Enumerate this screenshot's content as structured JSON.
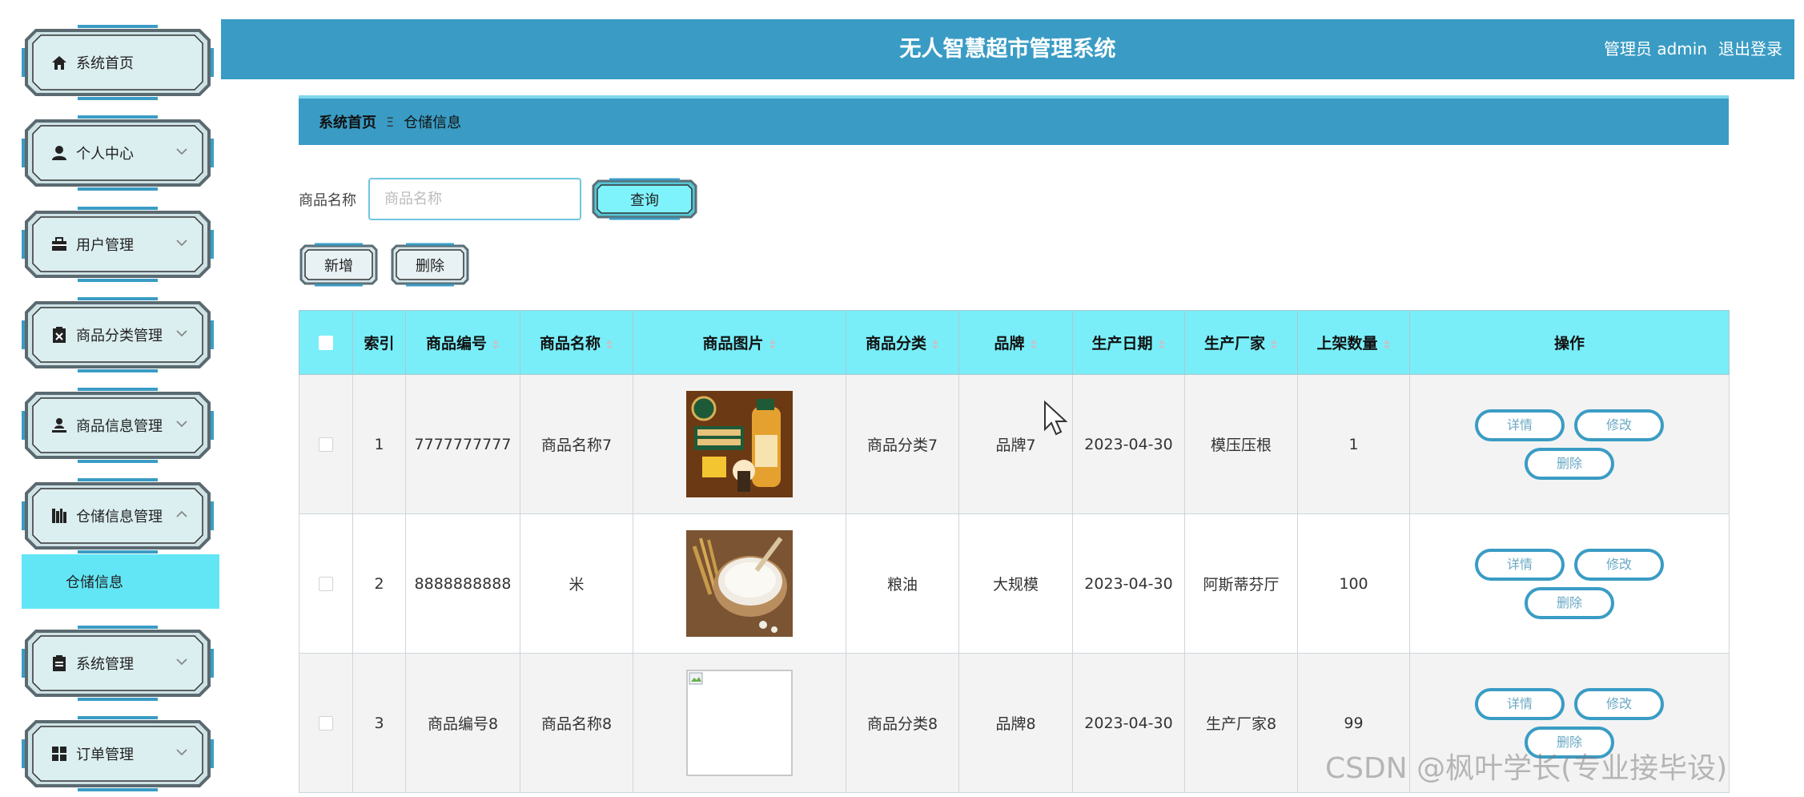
{
  "app": {
    "title": "无人智慧超市管理系统"
  },
  "header": {
    "user_label": "管理员 admin",
    "logout_label": "退出登录"
  },
  "sidebar": {
    "items": [
      {
        "label": "系统首页",
        "icon": "home-icon",
        "has_chevron": false
      },
      {
        "label": "个人中心",
        "icon": "user-icon",
        "has_chevron": true
      },
      {
        "label": "用户管理",
        "icon": "briefcase-icon",
        "has_chevron": true
      },
      {
        "label": "商品分类管理",
        "icon": "clipboard-x-icon",
        "has_chevron": true
      },
      {
        "label": "商品信息管理",
        "icon": "person-upload-icon",
        "has_chevron": true
      },
      {
        "label": "仓储信息管理",
        "icon": "bookshelf-icon",
        "has_chevron": true,
        "expanded": true
      },
      {
        "label": "系统管理",
        "icon": "clipboard-icon",
        "has_chevron": true
      },
      {
        "label": "订单管理",
        "icon": "grid-icon",
        "has_chevron": true
      }
    ],
    "sub_item": {
      "label": "仓储信息"
    }
  },
  "breadcrumb": {
    "home": "系统首页",
    "separator": "Ξ",
    "current": "仓储信息"
  },
  "search": {
    "label": "商品名称",
    "placeholder": "商品名称",
    "value": "",
    "query_button": "查询"
  },
  "toolbar": {
    "add_label": "新增",
    "delete_label": "删除"
  },
  "table": {
    "headers": [
      "",
      "索引",
      "商品编号",
      "商品名称",
      "商品图片",
      "商品分类",
      "品牌",
      "生产日期",
      "生产厂家",
      "上架数量",
      "操作"
    ],
    "rows": [
      {
        "index": "1",
        "code": "7777777777",
        "name": "商品名称7",
        "image": "oil-bottle-image",
        "category": "商品分类7",
        "brand": "品牌7",
        "date": "2023-04-30",
        "maker": "模压压根",
        "qty": "1"
      },
      {
        "index": "2",
        "code": "8888888888",
        "name": "米",
        "image": "rice-bowl-image",
        "category": "粮油",
        "brand": "大规模",
        "date": "2023-04-30",
        "maker": "阿斯蒂芬厅",
        "qty": "100"
      },
      {
        "index": "3",
        "code": "商品编号8",
        "name": "商品名称8",
        "image": "broken-image",
        "category": "商品分类8",
        "brand": "品牌8",
        "date": "2023-04-30",
        "maker": "生产厂家8",
        "qty": "99"
      }
    ],
    "row_actions": {
      "detail": "详情",
      "edit": "修改",
      "delete": "删除"
    }
  },
  "watermark": "CSDN @枫叶学长(专业接毕设)",
  "colors": {
    "header": "#3a9cc4",
    "table_head": "#79eef8",
    "sub_active": "#62e6f5",
    "pill_border": "#3a9cc4"
  }
}
